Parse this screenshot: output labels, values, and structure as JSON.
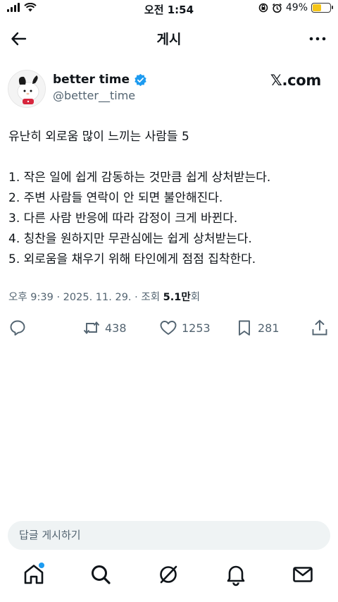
{
  "status_bar": {
    "time": "오전 1:54",
    "battery_percent": "49%",
    "battery_level": 0.49
  },
  "header": {
    "title": "게시"
  },
  "author": {
    "name": "better time",
    "handle": "@better__time",
    "verified": true,
    "source": "𝕏.com"
  },
  "post": {
    "headline": "유난히 외로움 많이 느끼는 사람들 5",
    "items": [
      "1. 작은 일에 쉽게 감동하는 것만큼 쉽게 상처받는다.",
      "2. 주변 사람들 연락이 안 되면 불안해진다.",
      "3. 다른 사람 반응에 따라 감정이 크게 바뀐다.",
      "4. 칭찬을 원하지만 무관심에는 쉽게 상처받는다.",
      "5. 외로움을 채우기 위해 타인에게 점점 집착한다."
    ]
  },
  "meta": {
    "timestamp": "오후 9:39 · 2025. 11. 29. · 조회 ",
    "views": "5.1만",
    "views_suffix": "회"
  },
  "actions": {
    "retweets": "438",
    "likes": "1253",
    "bookmarks": "281"
  },
  "reply_box": {
    "placeholder": "답글 게시하기"
  },
  "colors": {
    "accent": "#1d9bf0",
    "text": "#0f1419",
    "secondary": "#536471",
    "battery": "#f5c518"
  },
  "icons": [
    "signal-icon",
    "wifi-icon",
    "back-arrow-icon",
    "more-icon",
    "verified-badge-icon",
    "reply-icon",
    "retweet-icon",
    "like-icon",
    "bookmark-icon",
    "share-icon",
    "home-icon",
    "search-icon",
    "grok-icon",
    "notifications-icon",
    "messages-icon"
  ]
}
